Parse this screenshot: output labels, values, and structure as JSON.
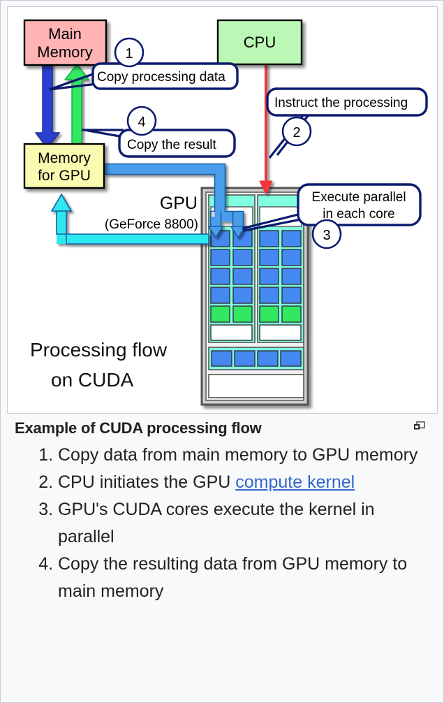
{
  "figure": {
    "alt": "Example of CUDA processing flow diagram",
    "bottom_label_line1": "Processing flow",
    "bottom_label_line2": "on CUDA",
    "blocks": {
      "main_memory": {
        "line1": "Main",
        "line2": "Memory",
        "fill": "#FFB3B3",
        "stroke": "#000000"
      },
      "cpu": {
        "line1": "CPU",
        "fill": "#BBF8B5",
        "stroke": "#000000"
      },
      "gpu_memory": {
        "line1": "Memory",
        "line2": "for GPU",
        "fill": "#FAFAB0",
        "stroke": "#000000"
      },
      "gpu": {
        "label": "GPU",
        "sublabel": "(GeForce 8800)",
        "body_fill": "#C9C9C9",
        "core_fill": "#4488F0",
        "core_alt_fill": "#33E863",
        "bus_fill": "#7FFFE0"
      }
    },
    "callouts": [
      {
        "number": "1",
        "text": "Copy processing data"
      },
      {
        "number": "2",
        "text": "Instruct the processing"
      },
      {
        "number": "3",
        "line1": "Execute parallel",
        "line2": "in each core"
      },
      {
        "number": "4",
        "text": "Copy the result"
      }
    ],
    "arrow_colors": {
      "down_blue": "#2A3FD0",
      "up_green": "#33E863",
      "cpu_red": "#F0343C",
      "pipe_blue": "#4A9DEA",
      "pipe_cyan": "#2EE8F0"
    }
  },
  "caption": {
    "title": "Example of CUDA processing flow",
    "enlarge_icon": "enlarge-icon",
    "steps": [
      {
        "text_before": "Copy data from main memory to GPU memory",
        "link": "",
        "text_after": ""
      },
      {
        "text_before": "CPU initiates the GPU ",
        "link": "compute kernel",
        "text_after": ""
      },
      {
        "text_before": "GPU's CUDA cores execute the kernel in parallel",
        "link": "",
        "text_after": ""
      },
      {
        "text_before": "Copy the resulting data from GPU memory to main memory",
        "link": "",
        "text_after": ""
      }
    ]
  }
}
